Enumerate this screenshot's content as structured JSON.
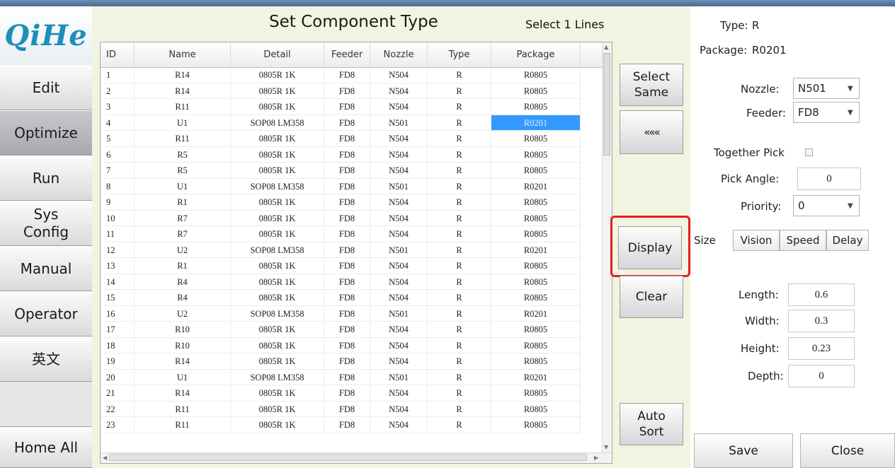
{
  "app": {
    "logo": "QiHe"
  },
  "nav": [
    {
      "label": "Edit",
      "active": false
    },
    {
      "label": "Optimize",
      "active": true
    },
    {
      "label": "Run",
      "active": false
    },
    {
      "label": "Sys Config",
      "active": false
    },
    {
      "label": "Manual",
      "active": false
    },
    {
      "label": "Operator",
      "active": false
    },
    {
      "label": "英文",
      "active": false
    },
    {
      "label": "Home All",
      "active": false
    }
  ],
  "main": {
    "title": "Set Component Type",
    "selection_status": "Select 1 Lines",
    "columns": [
      "ID",
      "Name",
      "Detail",
      "Feeder",
      "Nozzle",
      "Type",
      "Package"
    ],
    "selected_row_id": "4",
    "rows": [
      [
        "1",
        "R14",
        "0805R 1K",
        "FD8",
        "N504",
        "R",
        "R0805"
      ],
      [
        "2",
        "R14",
        "0805R 1K",
        "FD8",
        "N504",
        "R",
        "R0805"
      ],
      [
        "3",
        "R11",
        "0805R 1K",
        "FD8",
        "N504",
        "R",
        "R0805"
      ],
      [
        "4",
        "U1",
        "SOP08 LM358",
        "FD8",
        "N501",
        "R",
        "R0201"
      ],
      [
        "5",
        "R11",
        "0805R 1K",
        "FD8",
        "N504",
        "R",
        "R0805"
      ],
      [
        "6",
        "R5",
        "0805R 1K",
        "FD8",
        "N504",
        "R",
        "R0805"
      ],
      [
        "7",
        "R5",
        "0805R 1K",
        "FD8",
        "N504",
        "R",
        "R0805"
      ],
      [
        "8",
        "U1",
        "SOP08 LM358",
        "FD8",
        "N501",
        "R",
        "R0201"
      ],
      [
        "9",
        "R1",
        "0805R 1K",
        "FD8",
        "N504",
        "R",
        "R0805"
      ],
      [
        "10",
        "R7",
        "0805R 1K",
        "FD8",
        "N504",
        "R",
        "R0805"
      ],
      [
        "11",
        "R7",
        "0805R 1K",
        "FD8",
        "N504",
        "R",
        "R0805"
      ],
      [
        "12",
        "U2",
        "SOP08 LM358",
        "FD8",
        "N501",
        "R",
        "R0201"
      ],
      [
        "13",
        "R1",
        "0805R 1K",
        "FD8",
        "N504",
        "R",
        "R0805"
      ],
      [
        "14",
        "R4",
        "0805R 1K",
        "FD8",
        "N504",
        "R",
        "R0805"
      ],
      [
        "15",
        "R4",
        "0805R 1K",
        "FD8",
        "N504",
        "R",
        "R0805"
      ],
      [
        "16",
        "U2",
        "SOP08 LM358",
        "FD8",
        "N501",
        "R",
        "R0201"
      ],
      [
        "17",
        "R10",
        "0805R 1K",
        "FD8",
        "N504",
        "R",
        "R0805"
      ],
      [
        "18",
        "R10",
        "0805R 1K",
        "FD8",
        "N504",
        "R",
        "R0805"
      ],
      [
        "19",
        "R14",
        "0805R 1K",
        "FD8",
        "N504",
        "R",
        "R0805"
      ],
      [
        "20",
        "U1",
        "SOP08 LM358",
        "FD8",
        "N501",
        "R",
        "R0201"
      ],
      [
        "21",
        "R14",
        "0805R 1K",
        "FD8",
        "N504",
        "R",
        "R0805"
      ],
      [
        "22",
        "R11",
        "0805R 1K",
        "FD8",
        "N504",
        "R",
        "R0805"
      ],
      [
        "23",
        "R11",
        "0805R 1K",
        "FD8",
        "N504",
        "R",
        "R0805"
      ]
    ]
  },
  "actions": {
    "select_same": "Select Same",
    "back": "«««",
    "display": "Display",
    "clear": "Clear",
    "auto_sort": "Auto Sort"
  },
  "detail": {
    "type_label": "Type:",
    "type_value": "R",
    "package_label": "Package:",
    "package_value": "R0201",
    "nozzle_label": "Nozzle:",
    "nozzle_value": "N501",
    "feeder_label": "Feeder:",
    "feeder_value": "FD8",
    "together_pick_label": "Together Pick",
    "together_pick_checked": false,
    "pick_angle_label": "Pick Angle:",
    "pick_angle_value": "0",
    "priority_label": "Priority:",
    "priority_value": "0",
    "tabs": [
      "Size",
      "Vision",
      "Speed",
      "Delay"
    ],
    "active_tab": "Size",
    "length_label": "Length:",
    "length_value": "0.6",
    "width_label": "Width:",
    "width_value": "0.3",
    "height_label": "Height:",
    "height_value": "0.23",
    "depth_label": "Depth:",
    "depth_value": "0"
  },
  "footer": {
    "save": "Save",
    "close": "Close"
  },
  "colors": {
    "selection": "#3399ff",
    "highlight_box": "#e02020",
    "panel": "#f3f3e1",
    "logo": "#1d8fb8"
  }
}
